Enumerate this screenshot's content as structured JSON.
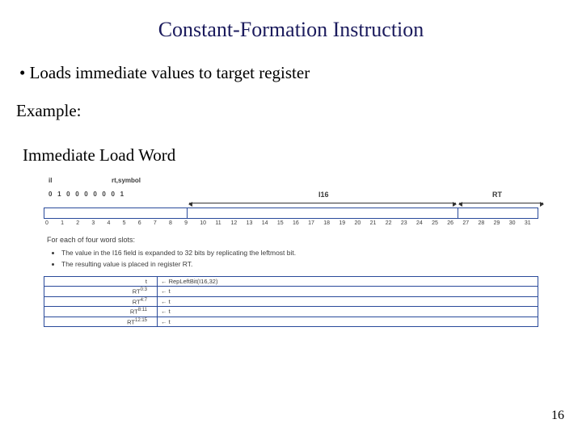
{
  "title": "Constant-Formation Instruction",
  "bullet1": "Loads immediate values to target register",
  "example_label": "Example:",
  "subhead": "Immediate Load Word",
  "mnemonic": "il",
  "operands": "rt,symbol",
  "opcode_bits": "0 1 0 0 0 0 0 0 1",
  "field_i16": "I16",
  "field_rt": "RT",
  "bit_numbers": [
    "0",
    "1",
    "2",
    "3",
    "4",
    "5",
    "6",
    "7",
    "8",
    "9",
    "10",
    "11",
    "12",
    "13",
    "14",
    "15",
    "16",
    "17",
    "18",
    "19",
    "20",
    "21",
    "22",
    "23",
    "24",
    "25",
    "26",
    "27",
    "28",
    "29",
    "30",
    "31"
  ],
  "desc_intro": "For each of four word slots:",
  "desc_items": [
    "The value in the I16 field is expanded to 32 bits by replicating the leftmost bit.",
    "The resulting value is placed in register RT."
  ],
  "rows": [
    {
      "lhs_base": "t",
      "lhs_sup": "",
      "rhs": "← RepLeftBit(I16,32)"
    },
    {
      "lhs_base": "RT",
      "lhs_sup": "0:3",
      "rhs": "← t"
    },
    {
      "lhs_base": "RT",
      "lhs_sup": "4:7",
      "rhs": "← t"
    },
    {
      "lhs_base": "RT",
      "lhs_sup": "8:11",
      "rhs": "← t"
    },
    {
      "lhs_base": "RT",
      "lhs_sup": "12:15",
      "rhs": "← t"
    }
  ],
  "page": "16"
}
